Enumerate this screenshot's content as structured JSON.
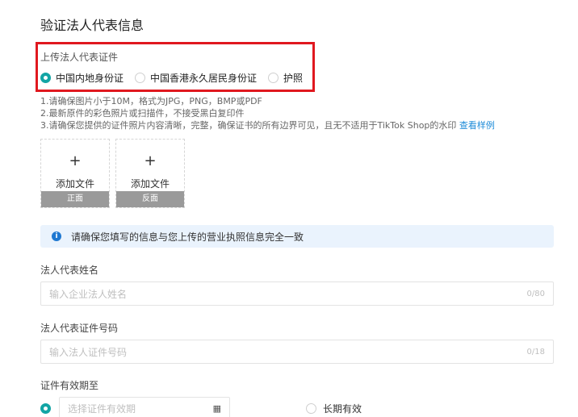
{
  "page": {
    "title": "验证法人代表信息"
  },
  "upload_doc": {
    "label": "上传法人代表证件",
    "options": [
      {
        "label": "中国内地身份证",
        "selected": true
      },
      {
        "label": "中国香港永久居民身份证",
        "selected": false
      },
      {
        "label": "护照",
        "selected": false
      }
    ]
  },
  "notes": {
    "line1": "1.请确保图片小于10M，格式为JPG，PNG，BMP或PDF",
    "line2": "2.最新原件的彩色照片或扫描件，不接受黑白复印件",
    "line3": "3.请确保您提供的证件照片内容清晰，完整，确保证书的所有边界可见，且无不适用于TikTok Shop的水印",
    "example_link": "查看样例"
  },
  "uploads": [
    {
      "plus": "+",
      "add_label": "添加文件",
      "side": "正面"
    },
    {
      "plus": "+",
      "add_label": "添加文件",
      "side": "反面"
    }
  ],
  "info_bar": {
    "text": "请确保您填写的信息与您上传的营业执照信息完全一致",
    "icon": "info-icon"
  },
  "name_field": {
    "label": "法人代表姓名",
    "placeholder": "输入企业法人姓名",
    "counter": "0/80"
  },
  "id_field": {
    "label": "法人代表证件号码",
    "placeholder": "输入法人证件号码",
    "counter": "0/18"
  },
  "validity": {
    "label": "证件有效期至",
    "date_placeholder": "选择证件有效期",
    "long_term_label": "长期有效"
  },
  "colors": {
    "accent": "#13a5a5",
    "highlight": "#e0181f",
    "link": "#1d8bd8",
    "info_bg": "#eaf3fd"
  }
}
